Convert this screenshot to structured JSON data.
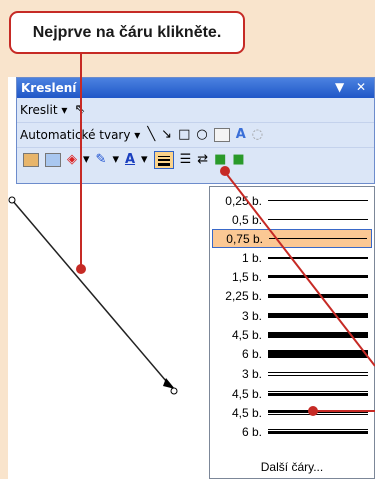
{
  "callout": {
    "text": "Nejprve na čáru klikněte."
  },
  "toolbar": {
    "title": "Kreslení",
    "title_dropdown": "▼",
    "close": "✕",
    "draw_menu": "Kreslit",
    "draw_menu_arrow": "▾",
    "autoshapes": "Automatické tvary",
    "autoshapes_arrow": "▾"
  },
  "line_menu": {
    "items": [
      {
        "label": "0,25 b.",
        "weight": 0.5
      },
      {
        "label": "0,5 b.",
        "weight": 1
      },
      {
        "label": "0,75 b.",
        "weight": 1.5,
        "selected": true
      },
      {
        "label": "1 b.",
        "weight": 2
      },
      {
        "label": "1,5 b.",
        "weight": 3
      },
      {
        "label": "2,25 b.",
        "weight": 4
      },
      {
        "label": "3 b.",
        "weight": 5
      },
      {
        "label": "4,5 b.",
        "weight": 6
      },
      {
        "label": "6 b.",
        "weight": 8
      },
      {
        "label": "3 b.",
        "style": "double"
      },
      {
        "label": "4,5 b.",
        "style": "thin-thick"
      },
      {
        "label": "4,5 b.",
        "style": "thick-thin"
      },
      {
        "label": "6 b.",
        "style": "triple"
      }
    ],
    "more_lines": "Další čáry..."
  },
  "colors": {
    "accent": "#c62a25",
    "background": "#f9e4cc",
    "toolbar": "#dbe6f7",
    "title_bar": "#2057c7",
    "highlight": "#fbc894"
  }
}
